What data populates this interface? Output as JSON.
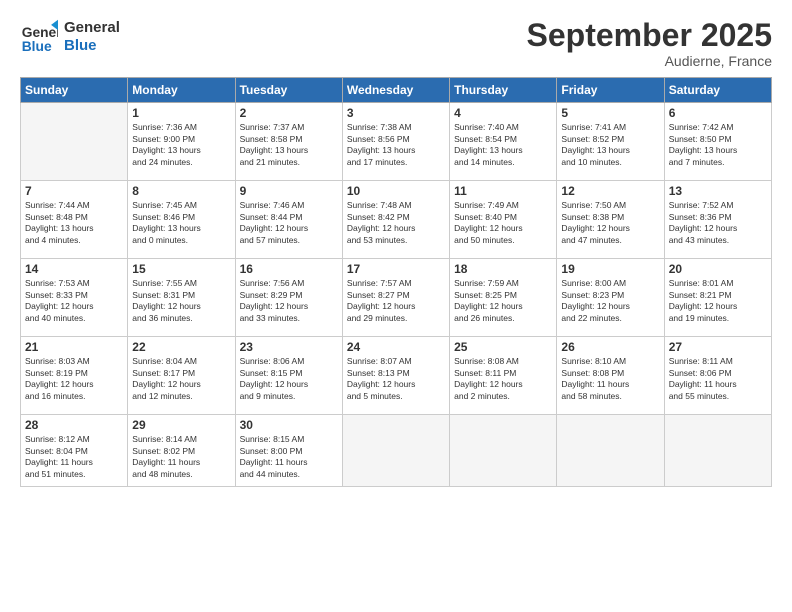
{
  "logo": {
    "line1": "General",
    "line2": "Blue"
  },
  "title": "September 2025",
  "location": "Audierne, France",
  "days_header": [
    "Sunday",
    "Monday",
    "Tuesday",
    "Wednesday",
    "Thursday",
    "Friday",
    "Saturday"
  ],
  "weeks": [
    [
      {
        "day": "",
        "info": ""
      },
      {
        "day": "1",
        "info": "Sunrise: 7:36 AM\nSunset: 9:00 PM\nDaylight: 13 hours\nand 24 minutes."
      },
      {
        "day": "2",
        "info": "Sunrise: 7:37 AM\nSunset: 8:58 PM\nDaylight: 13 hours\nand 21 minutes."
      },
      {
        "day": "3",
        "info": "Sunrise: 7:38 AM\nSunset: 8:56 PM\nDaylight: 13 hours\nand 17 minutes."
      },
      {
        "day": "4",
        "info": "Sunrise: 7:40 AM\nSunset: 8:54 PM\nDaylight: 13 hours\nand 14 minutes."
      },
      {
        "day": "5",
        "info": "Sunrise: 7:41 AM\nSunset: 8:52 PM\nDaylight: 13 hours\nand 10 minutes."
      },
      {
        "day": "6",
        "info": "Sunrise: 7:42 AM\nSunset: 8:50 PM\nDaylight: 13 hours\nand 7 minutes."
      }
    ],
    [
      {
        "day": "7",
        "info": "Sunrise: 7:44 AM\nSunset: 8:48 PM\nDaylight: 13 hours\nand 4 minutes."
      },
      {
        "day": "8",
        "info": "Sunrise: 7:45 AM\nSunset: 8:46 PM\nDaylight: 13 hours\nand 0 minutes."
      },
      {
        "day": "9",
        "info": "Sunrise: 7:46 AM\nSunset: 8:44 PM\nDaylight: 12 hours\nand 57 minutes."
      },
      {
        "day": "10",
        "info": "Sunrise: 7:48 AM\nSunset: 8:42 PM\nDaylight: 12 hours\nand 53 minutes."
      },
      {
        "day": "11",
        "info": "Sunrise: 7:49 AM\nSunset: 8:40 PM\nDaylight: 12 hours\nand 50 minutes."
      },
      {
        "day": "12",
        "info": "Sunrise: 7:50 AM\nSunset: 8:38 PM\nDaylight: 12 hours\nand 47 minutes."
      },
      {
        "day": "13",
        "info": "Sunrise: 7:52 AM\nSunset: 8:36 PM\nDaylight: 12 hours\nand 43 minutes."
      }
    ],
    [
      {
        "day": "14",
        "info": "Sunrise: 7:53 AM\nSunset: 8:33 PM\nDaylight: 12 hours\nand 40 minutes."
      },
      {
        "day": "15",
        "info": "Sunrise: 7:55 AM\nSunset: 8:31 PM\nDaylight: 12 hours\nand 36 minutes."
      },
      {
        "day": "16",
        "info": "Sunrise: 7:56 AM\nSunset: 8:29 PM\nDaylight: 12 hours\nand 33 minutes."
      },
      {
        "day": "17",
        "info": "Sunrise: 7:57 AM\nSunset: 8:27 PM\nDaylight: 12 hours\nand 29 minutes."
      },
      {
        "day": "18",
        "info": "Sunrise: 7:59 AM\nSunset: 8:25 PM\nDaylight: 12 hours\nand 26 minutes."
      },
      {
        "day": "19",
        "info": "Sunrise: 8:00 AM\nSunset: 8:23 PM\nDaylight: 12 hours\nand 22 minutes."
      },
      {
        "day": "20",
        "info": "Sunrise: 8:01 AM\nSunset: 8:21 PM\nDaylight: 12 hours\nand 19 minutes."
      }
    ],
    [
      {
        "day": "21",
        "info": "Sunrise: 8:03 AM\nSunset: 8:19 PM\nDaylight: 12 hours\nand 16 minutes."
      },
      {
        "day": "22",
        "info": "Sunrise: 8:04 AM\nSunset: 8:17 PM\nDaylight: 12 hours\nand 12 minutes."
      },
      {
        "day": "23",
        "info": "Sunrise: 8:06 AM\nSunset: 8:15 PM\nDaylight: 12 hours\nand 9 minutes."
      },
      {
        "day": "24",
        "info": "Sunrise: 8:07 AM\nSunset: 8:13 PM\nDaylight: 12 hours\nand 5 minutes."
      },
      {
        "day": "25",
        "info": "Sunrise: 8:08 AM\nSunset: 8:11 PM\nDaylight: 12 hours\nand 2 minutes."
      },
      {
        "day": "26",
        "info": "Sunrise: 8:10 AM\nSunset: 8:08 PM\nDaylight: 11 hours\nand 58 minutes."
      },
      {
        "day": "27",
        "info": "Sunrise: 8:11 AM\nSunset: 8:06 PM\nDaylight: 11 hours\nand 55 minutes."
      }
    ],
    [
      {
        "day": "28",
        "info": "Sunrise: 8:12 AM\nSunset: 8:04 PM\nDaylight: 11 hours\nand 51 minutes."
      },
      {
        "day": "29",
        "info": "Sunrise: 8:14 AM\nSunset: 8:02 PM\nDaylight: 11 hours\nand 48 minutes."
      },
      {
        "day": "30",
        "info": "Sunrise: 8:15 AM\nSunset: 8:00 PM\nDaylight: 11 hours\nand 44 minutes."
      },
      {
        "day": "",
        "info": ""
      },
      {
        "day": "",
        "info": ""
      },
      {
        "day": "",
        "info": ""
      },
      {
        "day": "",
        "info": ""
      }
    ]
  ]
}
